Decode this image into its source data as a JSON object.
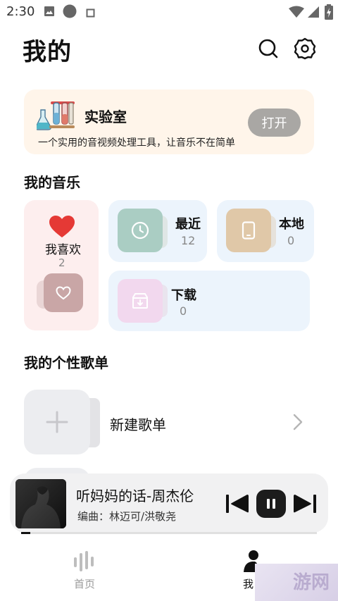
{
  "status_bar": {
    "time": "2:30"
  },
  "header": {
    "title": "我的"
  },
  "lab": {
    "title": "实验室",
    "description": "一个实用的音视频处理工具，让音乐不在简单",
    "open_label": "打开"
  },
  "my_music": {
    "title": "我的音乐",
    "favorites": {
      "label": "我喜欢",
      "count": "2"
    },
    "recent": {
      "label": "最近",
      "count": "12"
    },
    "local": {
      "label": "本地",
      "count": "0"
    },
    "downloads": {
      "label": "下载",
      "count": "0"
    }
  },
  "playlists": {
    "title": "我的个性歌单",
    "new_label": "新建歌单"
  },
  "player": {
    "song": "听妈妈的话-周杰伦",
    "composer": "编曲：林迈可/洪敬尧",
    "progress": 0.03
  },
  "nav": {
    "items": [
      {
        "label": "首页"
      },
      {
        "label": "我"
      }
    ]
  },
  "watermark": {
    "text": "游网"
  },
  "colors": {
    "favorite": "#e53935",
    "accent": "#111111"
  }
}
